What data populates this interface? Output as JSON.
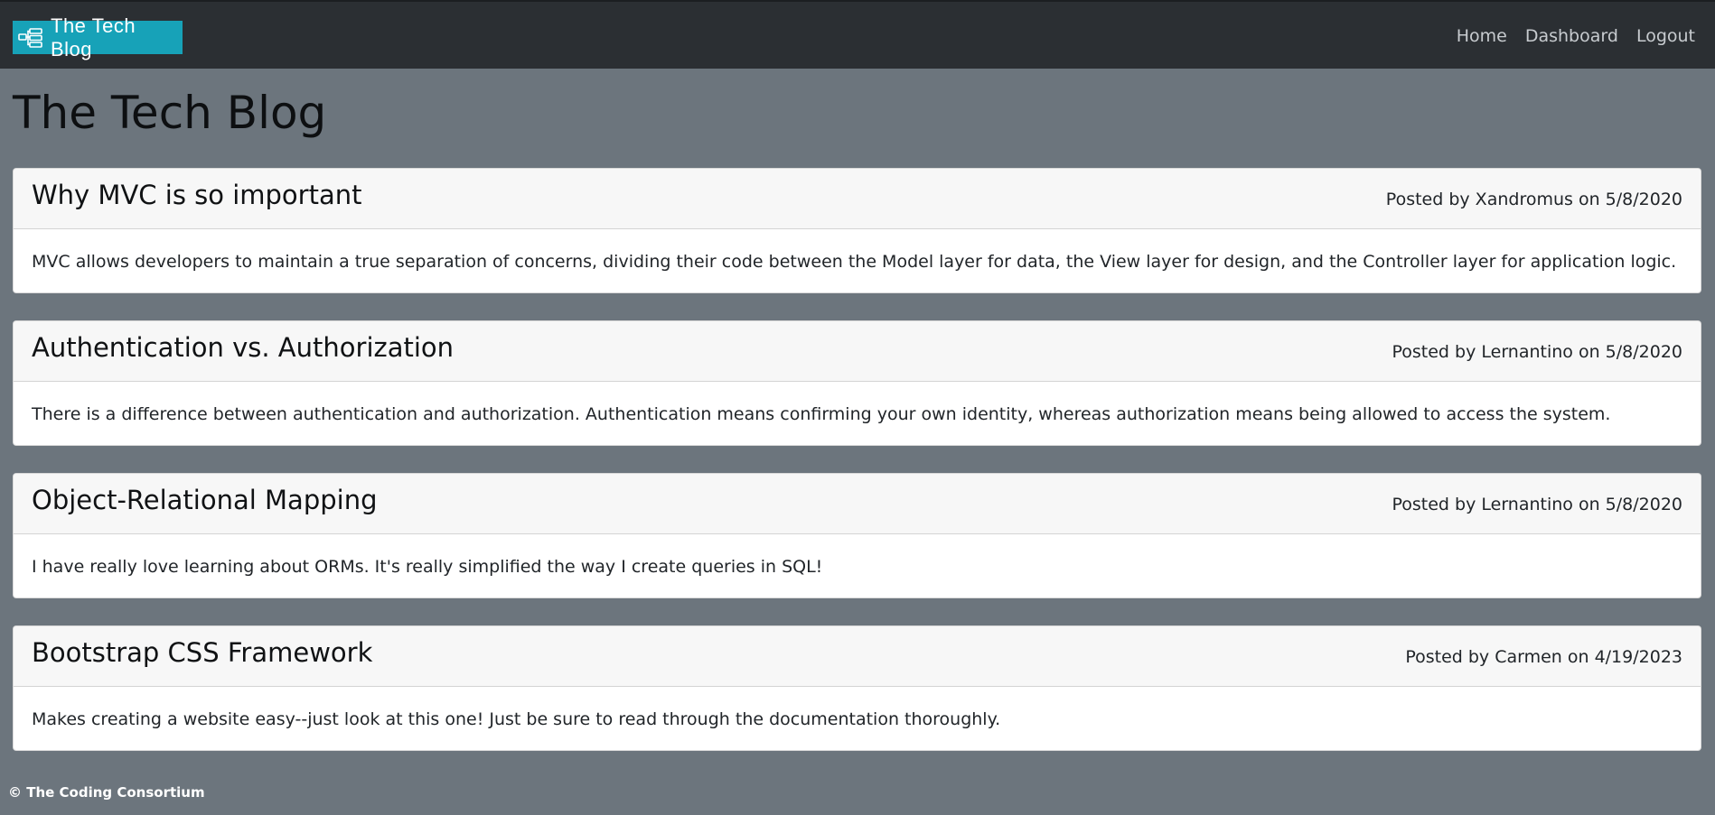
{
  "navbar": {
    "brand_text": "The Tech Blog",
    "brand_icon": "sitemap-icon",
    "links": [
      {
        "label": "Home"
      },
      {
        "label": "Dashboard"
      },
      {
        "label": "Logout"
      }
    ]
  },
  "page": {
    "title": "The Tech Blog"
  },
  "posts": [
    {
      "title": "Why MVC is so important",
      "meta": "Posted by Xandromus on 5/8/2020",
      "body": "MVC allows developers to maintain a true separation of concerns, dividing their code between the Model layer for data, the View layer for design, and the Controller layer for application logic."
    },
    {
      "title": "Authentication vs. Authorization",
      "meta": "Posted by Lernantino on 5/8/2020",
      "body": "There is a difference between authentication and authorization. Authentication means confirming your own identity, whereas authorization means being allowed to access the system."
    },
    {
      "title": "Object-Relational Mapping",
      "meta": "Posted by Lernantino on 5/8/2020",
      "body": "I have really love learning about ORMs. It's really simplified the way I create queries in SQL!"
    },
    {
      "title": "Bootstrap CSS Framework",
      "meta": "Posted by Carmen on 4/19/2023",
      "body": "Makes creating a website easy--just look at this one! Just be sure to read through the documentation thoroughly."
    }
  ],
  "footer": {
    "text": "© The Coding Consortium"
  },
  "colors": {
    "navbar_bg": "#2b2f33",
    "brand_bg": "#17a2b8",
    "page_bg": "#6c757d",
    "card_header_bg": "#f7f7f7"
  }
}
